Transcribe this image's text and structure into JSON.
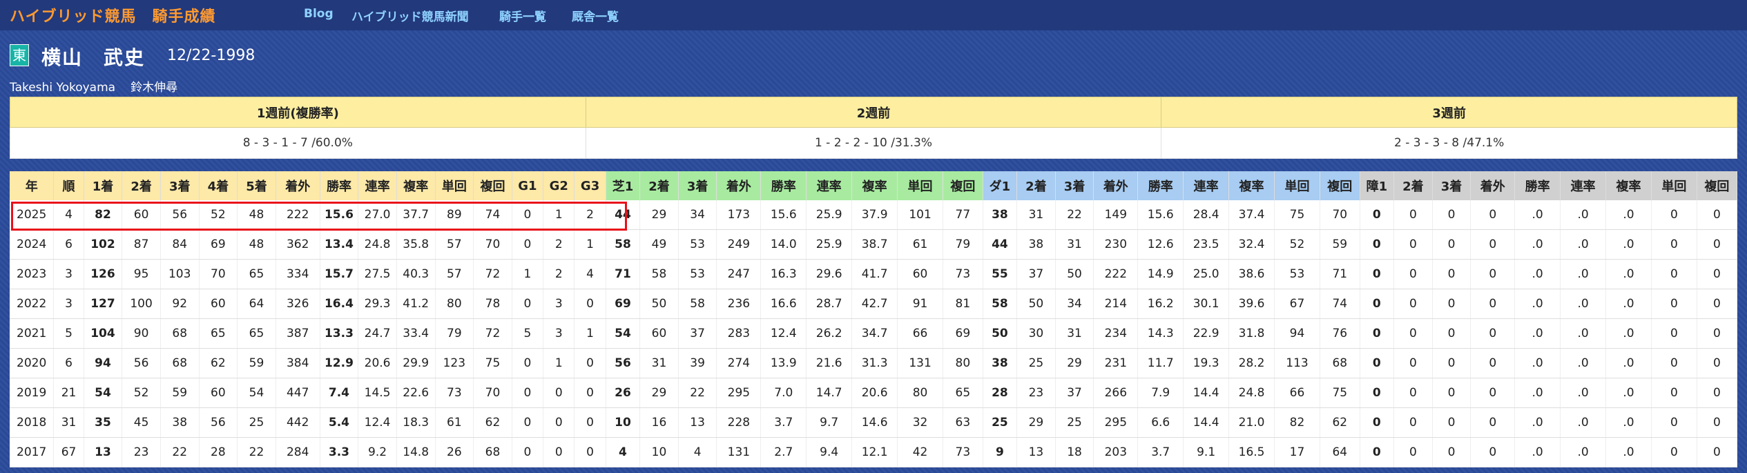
{
  "site_title": "ハイブリッド競馬　騎手成績",
  "nav": [
    "Blog",
    "ハイブリッド競馬新聞",
    "騎手一覧",
    "厩舎一覧"
  ],
  "jockey": {
    "badge": "東",
    "name": "横山　武史",
    "date": "12/22-1998",
    "romaji": "Takeshi Yokoyama",
    "trainer": "鈴木伸尋"
  },
  "weeks": {
    "headers": [
      "1週前(複勝率)",
      "2週前",
      "3週前"
    ],
    "values": [
      "8 - 3 - 1 - 7 /60.0%",
      "1 - 2 - 2 - 10 /31.3%",
      "2 - 3 - 3 - 8 /47.1%"
    ]
  },
  "table": {
    "headers": [
      "年",
      "順",
      "1着",
      "2着",
      "3着",
      "4着",
      "5着",
      "着外",
      "勝率",
      "連率",
      "複率",
      "単回",
      "複回",
      "G1",
      "G2",
      "G3",
      "芝1",
      "2着",
      "3着",
      "着外",
      "勝率",
      "連率",
      "複率",
      "単回",
      "複回",
      "ダ1",
      "2着",
      "3着",
      "着外",
      "勝率",
      "連率",
      "複率",
      "単回",
      "複回",
      "障1",
      "2着",
      "3着",
      "着外",
      "勝率",
      "連率",
      "複率",
      "単回",
      "複回"
    ],
    "rows": [
      [
        "2025",
        "4",
        "82",
        "60",
        "56",
        "52",
        "48",
        "222",
        "15.6",
        "27.0",
        "37.7",
        "89",
        "74",
        "0",
        "1",
        "2",
        "44",
        "29",
        "34",
        "173",
        "15.6",
        "25.9",
        "37.9",
        "101",
        "77",
        "38",
        "31",
        "22",
        "149",
        "15.6",
        "28.4",
        "37.4",
        "75",
        "70",
        "0",
        "0",
        "0",
        "0",
        ".0",
        ".0",
        ".0",
        "0",
        "0"
      ],
      [
        "2024",
        "6",
        "102",
        "87",
        "84",
        "69",
        "48",
        "362",
        "13.4",
        "24.8",
        "35.8",
        "57",
        "70",
        "0",
        "2",
        "1",
        "58",
        "49",
        "53",
        "249",
        "14.0",
        "25.9",
        "38.7",
        "61",
        "79",
        "44",
        "38",
        "31",
        "230",
        "12.6",
        "23.5",
        "32.4",
        "52",
        "59",
        "0",
        "0",
        "0",
        "0",
        ".0",
        ".0",
        ".0",
        "0",
        "0"
      ],
      [
        "2023",
        "3",
        "126",
        "95",
        "103",
        "70",
        "65",
        "334",
        "15.7",
        "27.5",
        "40.3",
        "57",
        "72",
        "1",
        "2",
        "4",
        "71",
        "58",
        "53",
        "247",
        "16.3",
        "29.6",
        "41.7",
        "60",
        "73",
        "55",
        "37",
        "50",
        "222",
        "14.9",
        "25.0",
        "38.6",
        "53",
        "71",
        "0",
        "0",
        "0",
        "0",
        ".0",
        ".0",
        ".0",
        "0",
        "0"
      ],
      [
        "2022",
        "3",
        "127",
        "100",
        "92",
        "60",
        "64",
        "326",
        "16.4",
        "29.3",
        "41.2",
        "80",
        "78",
        "0",
        "3",
        "0",
        "69",
        "50",
        "58",
        "236",
        "16.6",
        "28.7",
        "42.7",
        "91",
        "81",
        "58",
        "50",
        "34",
        "214",
        "16.2",
        "30.1",
        "39.6",
        "67",
        "74",
        "0",
        "0",
        "0",
        "0",
        ".0",
        ".0",
        ".0",
        "0",
        "0"
      ],
      [
        "2021",
        "5",
        "104",
        "90",
        "68",
        "65",
        "65",
        "387",
        "13.3",
        "24.7",
        "33.4",
        "79",
        "72",
        "5",
        "3",
        "1",
        "54",
        "60",
        "37",
        "283",
        "12.4",
        "26.2",
        "34.7",
        "66",
        "69",
        "50",
        "30",
        "31",
        "234",
        "14.3",
        "22.9",
        "31.8",
        "94",
        "76",
        "0",
        "0",
        "0",
        "0",
        ".0",
        ".0",
        ".0",
        "0",
        "0"
      ],
      [
        "2020",
        "6",
        "94",
        "56",
        "68",
        "62",
        "59",
        "384",
        "12.9",
        "20.6",
        "29.9",
        "123",
        "75",
        "0",
        "1",
        "0",
        "56",
        "31",
        "39",
        "274",
        "13.9",
        "21.6",
        "31.3",
        "131",
        "80",
        "38",
        "25",
        "29",
        "231",
        "11.7",
        "19.3",
        "28.2",
        "113",
        "68",
        "0",
        "0",
        "0",
        "0",
        ".0",
        ".0",
        ".0",
        "0",
        "0"
      ],
      [
        "2019",
        "21",
        "54",
        "52",
        "59",
        "60",
        "54",
        "447",
        "7.4",
        "14.5",
        "22.6",
        "73",
        "70",
        "0",
        "0",
        "0",
        "26",
        "29",
        "22",
        "295",
        "7.0",
        "14.7",
        "20.6",
        "80",
        "65",
        "28",
        "23",
        "37",
        "266",
        "7.9",
        "14.4",
        "24.8",
        "66",
        "75",
        "0",
        "0",
        "0",
        "0",
        ".0",
        ".0",
        ".0",
        "0",
        "0"
      ],
      [
        "2018",
        "31",
        "35",
        "45",
        "38",
        "56",
        "25",
        "442",
        "5.4",
        "12.4",
        "18.3",
        "61",
        "62",
        "0",
        "0",
        "0",
        "10",
        "16",
        "13",
        "228",
        "3.7",
        "9.7",
        "14.6",
        "32",
        "63",
        "25",
        "29",
        "25",
        "295",
        "6.6",
        "14.4",
        "21.0",
        "82",
        "62",
        "0",
        "0",
        "0",
        "0",
        ".0",
        ".0",
        ".0",
        "0",
        "0"
      ],
      [
        "2017",
        "67",
        "13",
        "23",
        "22",
        "28",
        "22",
        "284",
        "3.3",
        "9.2",
        "14.8",
        "26",
        "68",
        "0",
        "0",
        "0",
        "4",
        "10",
        "4",
        "131",
        "2.7",
        "9.4",
        "12.1",
        "42",
        "73",
        "9",
        "13",
        "18",
        "203",
        "3.7",
        "9.1",
        "16.5",
        "17",
        "64",
        "0",
        "0",
        "0",
        "0",
        ".0",
        ".0",
        ".0",
        "0",
        "0"
      ]
    ]
  },
  "colors": {
    "background": "#2a4a9a",
    "brand": "#ff9a30",
    "nav_link": "#8fd3ff",
    "overall_header": "#fde9a8",
    "turf_header": "#a8eba0",
    "dirt_header": "#a8ccf2",
    "jump_header": "#d0d0d0",
    "highlight_border": "#e8101a"
  }
}
